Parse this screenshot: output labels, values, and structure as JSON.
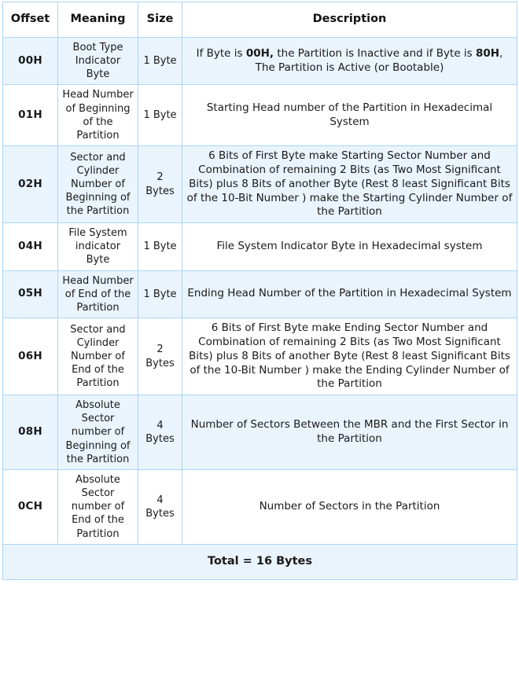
{
  "table": {
    "headers": {
      "offset": "Offset",
      "meaning": "Meaning",
      "size": "Size",
      "description": "Description"
    },
    "rows": [
      {
        "offset": "00H",
        "meaning": "Boot Type Indicator Byte",
        "size": "1 Byte",
        "description_pre": "If Byte is ",
        "description_b1": "00H,",
        "description_mid": " the Partition is Inactive and if Byte is ",
        "description_b2": "80H",
        "description_post": ", The Partition is Active (or Bootable)",
        "description_plain": "If Byte is 00H, the Partition is Inactive and if Byte is 80H, The Partition is Active (or Bootable)",
        "shaded": true
      },
      {
        "offset": "01H",
        "meaning": "Head Number of Beginning of the Partition",
        "size": "1 Byte",
        "description_plain": "Starting Head number of the Partition in Hexadecimal System",
        "shaded": false
      },
      {
        "offset": "02H",
        "meaning": "Sector and Cylinder Number of Beginning of the Partition",
        "size": "2 Bytes",
        "description_plain": "6 Bits of First Byte make Starting Sector Number and Combination of remaining 2 Bits (as Two Most Significant Bits) plus 8 Bits of another Byte (Rest 8 least Significant Bits of the 10-Bit Number ) make the Starting Cylinder Number of the Partition",
        "shaded": true
      },
      {
        "offset": "04H",
        "meaning": "File System indicator Byte",
        "size": "1 Byte",
        "description_plain": "File System Indicator Byte in Hexadecimal system",
        "shaded": false
      },
      {
        "offset": "05H",
        "meaning": "Head Number of End of the Partition",
        "size": "1 Byte",
        "description_plain": "Ending Head Number of the Partition in Hexadecimal System",
        "shaded": true
      },
      {
        "offset": "06H",
        "meaning": "Sector and Cylinder Number of End of the Partition",
        "size": "2 Bytes",
        "description_plain": "6 Bits of First Byte make Ending Sector Number and Combination of remaining 2 Bits (as Two Most Significant Bits) plus 8 Bits of another Byte (Rest 8 least Significant Bits of the 10-Bit Number ) make the Ending Cylinder Number of the Partition",
        "shaded": false
      },
      {
        "offset": "08H",
        "meaning": "Absolute Sector number of Beginning of the Partition",
        "size": "4 Bytes",
        "description_plain": "Number of Sectors Between the MBR and the First Sector in the Partition",
        "shaded": true
      },
      {
        "offset": "0CH",
        "meaning": "Absolute Sector number of End of the Partition",
        "size": "4 Bytes",
        "description_plain": "Number of Sectors in the Partition",
        "shaded": false
      }
    ],
    "footer": {
      "total_label": "Total = 16 Bytes"
    },
    "colors": {
      "border": "#a9d6f5",
      "shaded_row_bg": "#eaf4fd",
      "plain_row_bg": "#ffffff",
      "text": "#1a1a1a"
    }
  }
}
